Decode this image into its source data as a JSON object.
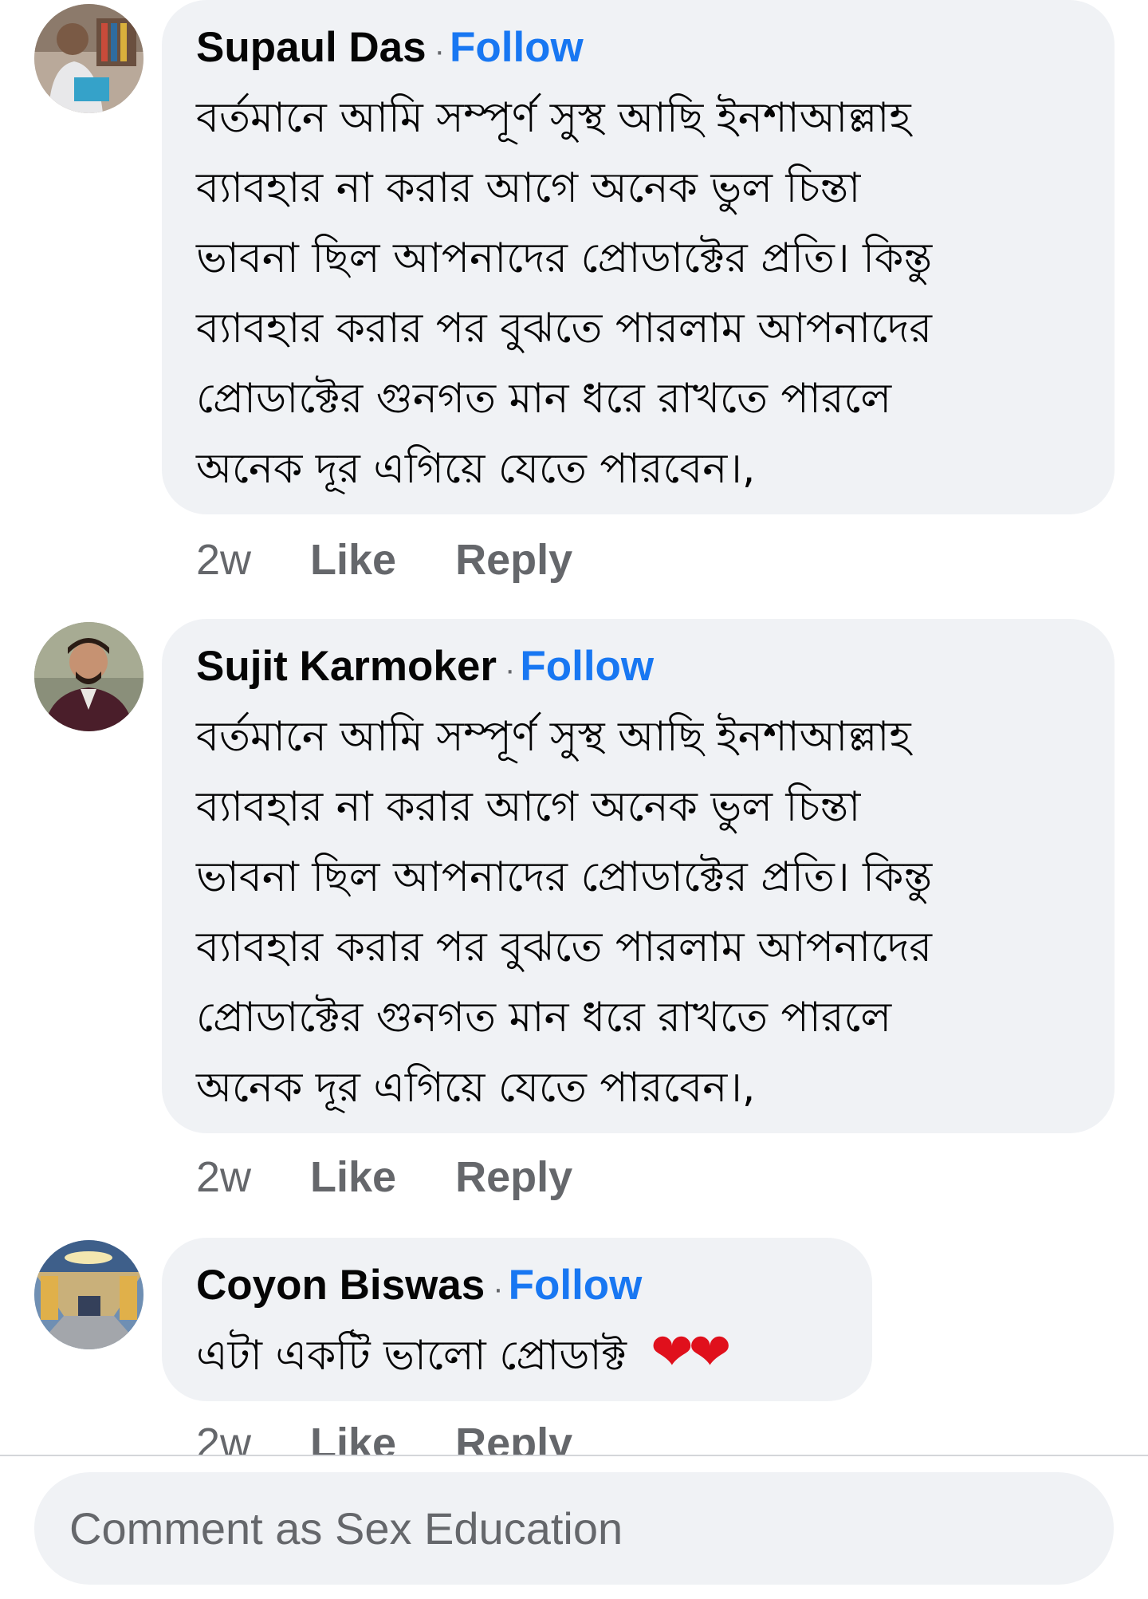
{
  "comments": [
    {
      "author": "Supaul Das",
      "separator": "·",
      "follow_label": "Follow",
      "text": "বর্তমানে আমি সম্পূর্ণ সুস্থ আছি ইনশাআল্লাহ\nব্যাবহার না করার আগে অনেক ভুল চিন্তা\nভাবনা ছিল আপনাদের প্রোডাক্টের প্রতি। কিন্তু\nব্যাবহার করার পর বুঝতে পারলাম আপনাদের\nপ্রোডাক্টের গুনগত মান ধরে রাখতে পারলে\nঅনেক দূর এগিয়ে যেতে পারবেন।,",
      "time": "2w",
      "like_label": "Like",
      "reply_label": "Reply",
      "avatar_icon": "profile-photo-man-with-book"
    },
    {
      "author": "Sujit Karmoker",
      "separator": "·",
      "follow_label": "Follow",
      "text": "বর্তমানে আমি সম্পূর্ণ সুস্থ আছি ইনশাআল্লাহ\nব্যাবহার না করার আগে অনেক ভুল চিন্তা\nভাবনা ছিল আপনাদের প্রোডাক্টের প্রতি। কিন্তু\nব্যাবহার করার পর বুঝতে পারলাম আপনাদের\nপ্রোডাক্টের গুনগত মান ধরে রাখতে পারলে\nঅনেক দূর এগিয়ে যেতে পারবেন।,",
      "time": "2w",
      "like_label": "Like",
      "reply_label": "Reply",
      "avatar_icon": "profile-photo-man-in-suit"
    },
    {
      "author": "Coyon Biswas",
      "separator": "·",
      "follow_label": "Follow",
      "text": "এটা একটি ভালো প্রোডাক্ট",
      "emoji": "❤❤",
      "time": "2w",
      "like_label": "Like",
      "reply_label": "Reply",
      "avatar_icon": "profile-photo-corridor"
    }
  ],
  "composer": {
    "placeholder": "Comment as Sex Education"
  },
  "colors": {
    "bubble_bg": "#f0f2f5",
    "follow_blue": "#1877f2",
    "secondary_text": "#65676b",
    "heart_red": "#e0101c"
  }
}
